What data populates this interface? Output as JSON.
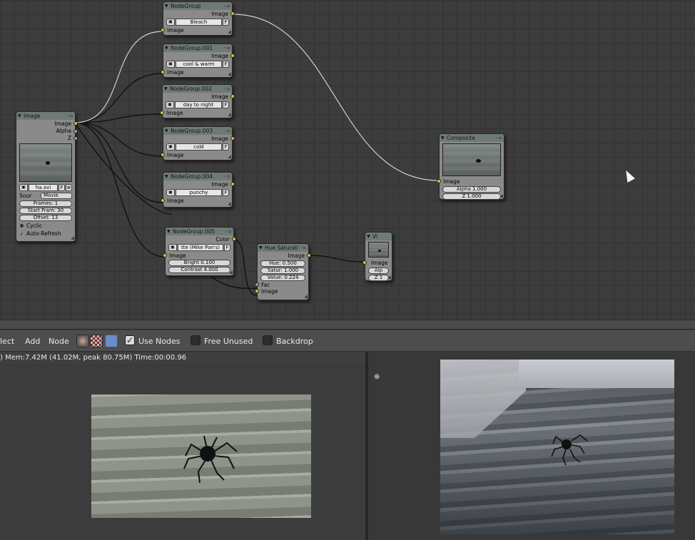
{
  "nodes": {
    "image_input": {
      "title": "Image",
      "out_image": "Image",
      "out_alpha": "Alpha",
      "out_z": "Z",
      "file": "ha.avi",
      "file_flag": "F",
      "source_label": "Sour",
      "source_value": "Movie",
      "frames": "Frames: 1",
      "start_frame": "Start Fram: 30",
      "offset": "Offset: 13",
      "cyclic": "Cyclic",
      "auto_refresh": "Auto-Refresh"
    },
    "groups": [
      {
        "title": "NodeGroup",
        "out": "Image",
        "value": "Bleach",
        "flag": "F",
        "in": "Image"
      },
      {
        "title": "NodeGroup.001",
        "out": "Image",
        "value": "cool & warm",
        "flag": "F",
        "in": "Image"
      },
      {
        "title": "NodeGroup.002",
        "out": "Image",
        "value": "day to night",
        "flag": "F",
        "in": "Image"
      },
      {
        "title": "NodeGroup.003",
        "out": "Image",
        "value": "cold",
        "flag": "F",
        "in": "Image"
      },
      {
        "title": "NodeGroup.004",
        "out": "Image",
        "value": "punchy",
        "flag": "F",
        "in": "Image"
      }
    ],
    "group5": {
      "title": "NodeGroup.005",
      "out": "Color",
      "value": "tte (Mike Pan's)",
      "flag": "F",
      "in": "Image",
      "bright": "Bright 0.100",
      "contrast": "Contrast 4.000"
    },
    "hue_sat": {
      "title": "Hue Saturati",
      "out": "Image",
      "hue": "Hue: 0.500",
      "satur": "Satur: 1.000",
      "value": "Value: 0.224",
      "fac": "Fac",
      "in": "Image"
    },
    "viewer": {
      "title": "Vi",
      "in": "Image",
      "alpha": "Alp",
      "z": "Z 1"
    },
    "composite": {
      "title": "Composite",
      "in": "Image",
      "alpha": "Alpha 1.000",
      "z": "Z 1.000"
    }
  },
  "toolbar": {
    "select": "lect",
    "add": "Add",
    "node": "Node",
    "use_nodes": "Use Nodes",
    "free_unused": "Free Unused",
    "backdrop": "Backdrop",
    "use_nodes_checked": true,
    "free_unused_checked": false,
    "backdrop_checked": false
  },
  "info": {
    "render_stats": ") Mem:7.42M (41.02M, peak 80.75M) Time:00:00.96"
  },
  "colors": {
    "socket": "#c7c72f",
    "node_body": "#8a8a8a",
    "node_header": "#6f7a77",
    "wire": "#111111",
    "wire_selected": "#cfcfcf"
  }
}
